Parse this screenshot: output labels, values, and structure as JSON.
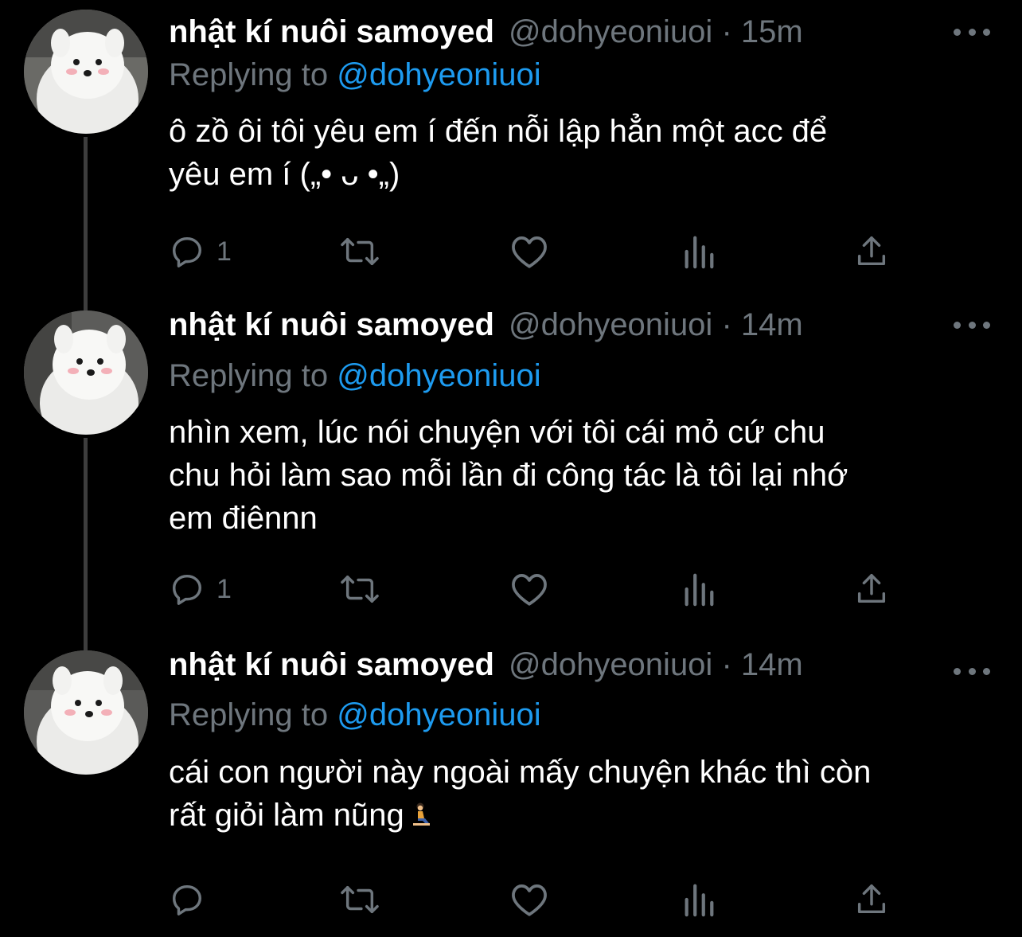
{
  "thread": {
    "tweets": [
      {
        "display_name": "nhật kí nuôi samoyed",
        "handle": "@dohyeoniuoi",
        "separator": "·",
        "time": "15m",
        "replying_prefix": "Replying to",
        "replying_handle": "@dohyeoniuoi",
        "text": "ô zồ ôi tôi yêu em í đến nỗi lập hẳn một acc để\nyêu em í („• ᴗ •„)",
        "reply_count": "1"
      },
      {
        "display_name": "nhật kí nuôi samoyed",
        "handle": "@dohyeoniuoi",
        "separator": "·",
        "time": "14m",
        "replying_prefix": "Replying to",
        "replying_handle": "@dohyeoniuoi",
        "text": "nhìn xem, lúc nói chuyện với tôi cái mỏ cứ chu\nchu hỏi làm sao mỗi lần đi công tác là tôi lại nhớ\nem điênnn",
        "reply_count": "1"
      },
      {
        "display_name": "nhật kí nuôi samoyed",
        "handle": "@dohyeoniuoi",
        "separator": "·",
        "time": "14m",
        "replying_prefix": "Replying to",
        "replying_handle": "@dohyeoniuoi",
        "text": "cái con người này ngoài mấy chuyện khác thì còn\nrất giỏi làm nũng",
        "reply_count": ""
      }
    ]
  },
  "icons": {
    "reply": "speech-bubble-icon",
    "retweet": "retweet-arrows-icon",
    "like": "heart-icon",
    "stats": "bar-chart-icon",
    "share": "share-upload-icon",
    "more": "ellipsis-icon",
    "emoji": "person-kneeling-emoji-icon",
    "avatar": "samoyed-dog-avatar"
  },
  "colors": {
    "background": "#000000",
    "text_primary": "#ffffff",
    "text_secondary": "#6e767d",
    "accent": "#1d9bf0",
    "thread_line": "#3d3d3d"
  }
}
